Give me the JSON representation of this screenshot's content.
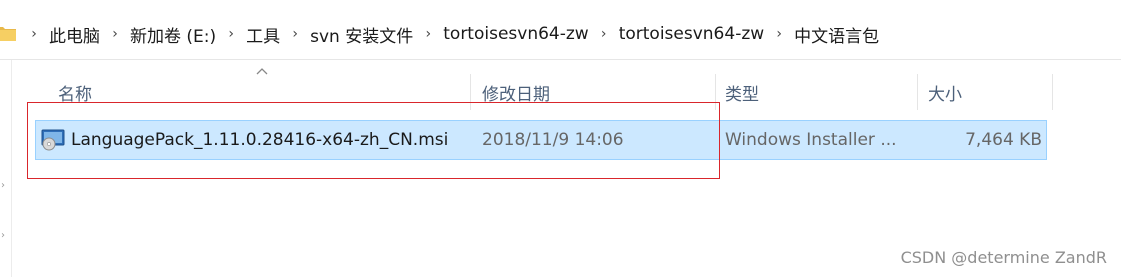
{
  "breadcrumb": {
    "items": [
      "此电脑",
      "新加卷 (E:)",
      "工具",
      "svn 安装文件",
      "tortoisesvn64-zw",
      "tortoisesvn64-zw",
      "中文语言包"
    ],
    "separator": "›"
  },
  "columns": {
    "name": "名称",
    "modified": "修改日期",
    "type": "类型",
    "size": "大小"
  },
  "file": {
    "name": "LanguagePack_1.11.0.28416-x64-zh_CN.msi",
    "modified": "2018/11/9 14:06",
    "type": "Windows Installer ...",
    "size": "7,464 KB",
    "icon": "msi-installer-icon",
    "selected": true
  },
  "watermark": "CSDN @determine  ZandR",
  "colors": {
    "selection_bg": "#cce8ff",
    "selection_border": "#99d1ff",
    "header_text": "#4c607a",
    "annotation": "#d9262c",
    "folder": "#e8b94a"
  }
}
